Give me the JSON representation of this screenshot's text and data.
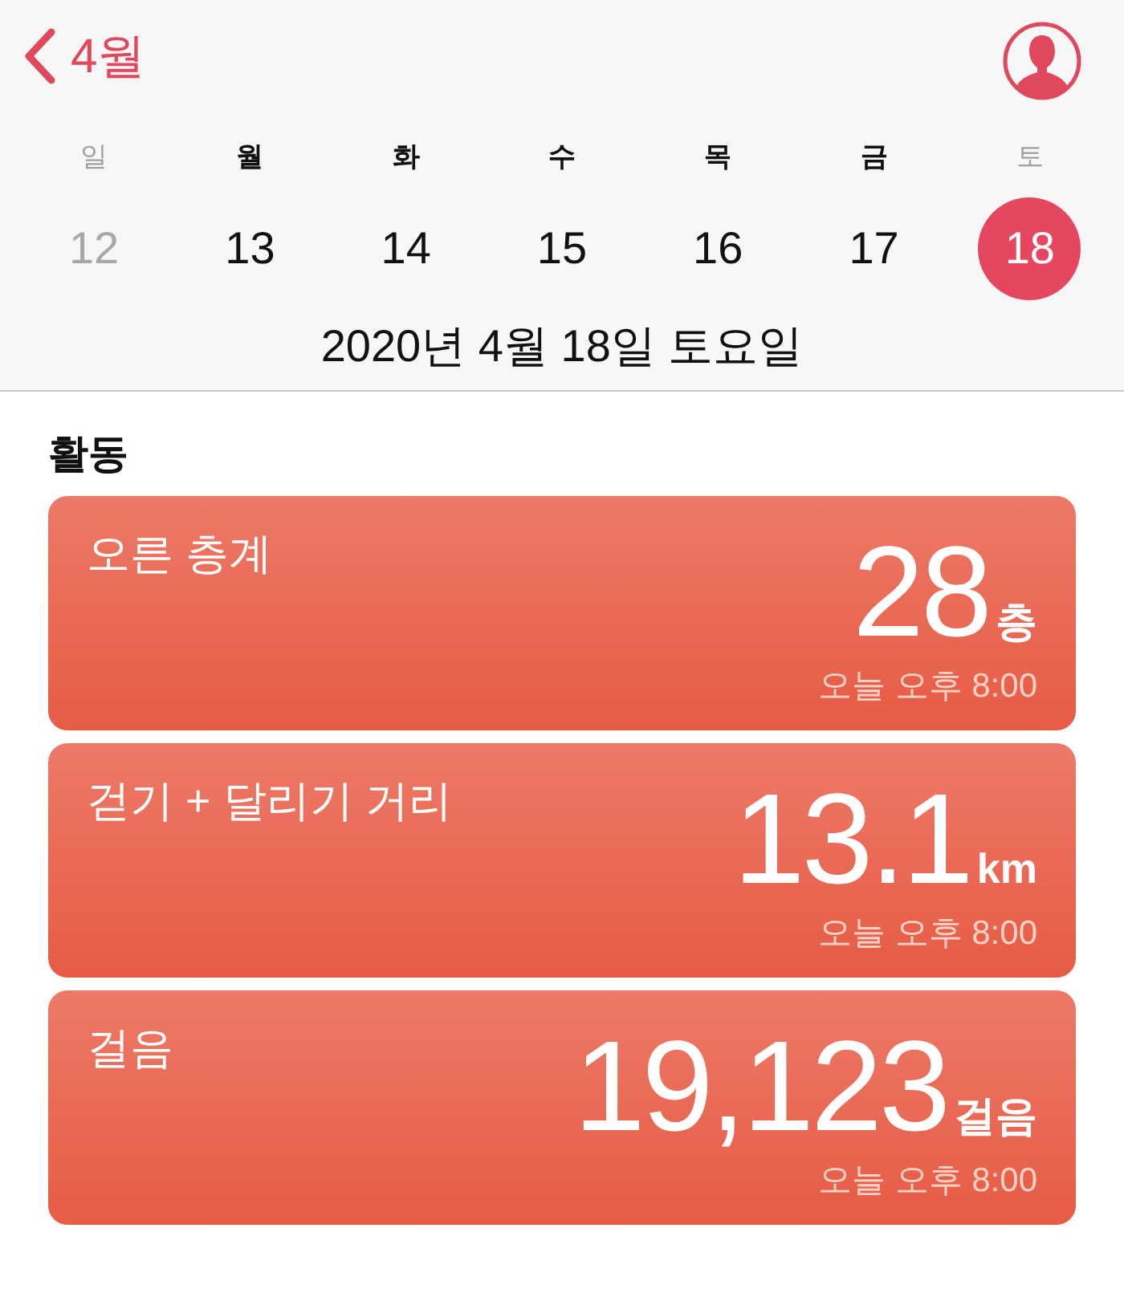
{
  "header": {
    "back_label": "4월"
  },
  "weekdays": [
    {
      "label": "일",
      "weekend": true
    },
    {
      "label": "월",
      "weekend": false
    },
    {
      "label": "화",
      "weekend": false
    },
    {
      "label": "수",
      "weekend": false
    },
    {
      "label": "목",
      "weekend": false
    },
    {
      "label": "금",
      "weekend": false
    },
    {
      "label": "토",
      "weekend": true
    }
  ],
  "days": [
    {
      "label": "12",
      "past_week": true,
      "selected": false
    },
    {
      "label": "13",
      "past_week": false,
      "selected": false
    },
    {
      "label": "14",
      "past_week": false,
      "selected": false
    },
    {
      "label": "15",
      "past_week": false,
      "selected": false
    },
    {
      "label": "16",
      "past_week": false,
      "selected": false
    },
    {
      "label": "17",
      "past_week": false,
      "selected": false
    },
    {
      "label": "18",
      "past_week": false,
      "selected": true
    }
  ],
  "date_line": "2020년 4월 18일 토요일",
  "section_title": "활동",
  "cards": [
    {
      "title": "오른 층계",
      "value": "28",
      "unit": "층",
      "time": "오늘 오후 8:00"
    },
    {
      "title": "걷기 + 달리기 거리",
      "value": "13.1",
      "unit": "km",
      "time": "오늘 오후 8:00"
    },
    {
      "title": "걸음",
      "value": "19,123",
      "unit": "걸음",
      "time": "오늘 오후 8:00"
    }
  ]
}
